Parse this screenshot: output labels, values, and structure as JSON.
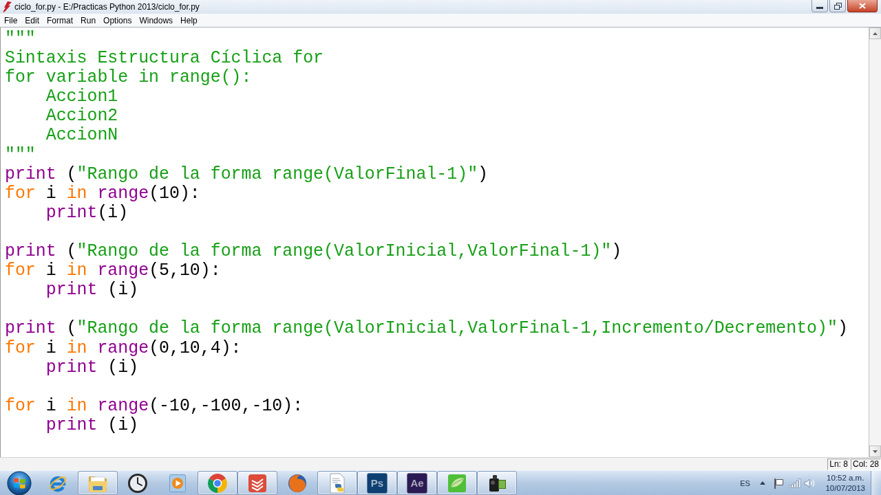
{
  "window": {
    "title": "ciclo_for.py - E:/Practicas Python 2013/ciclo_for.py"
  },
  "menu": [
    "File",
    "Edit",
    "Format",
    "Run",
    "Options",
    "Windows",
    "Help"
  ],
  "editor": {
    "lines": [
      {
        "kind": "code",
        "tokens": [
          {
            "kind": "string",
            "text": "\"\"\""
          }
        ]
      },
      {
        "kind": "code",
        "tokens": [
          {
            "kind": "string",
            "text": "Sintaxis Estructura Cíclica for"
          }
        ]
      },
      {
        "kind": "code",
        "tokens": [
          {
            "kind": "string",
            "text": "for variable in range():"
          }
        ],
        "children": [
          {
            "kind": "code",
            "tokens": [
              {
                "kind": "string",
                "text": "Accion1"
              }
            ]
          },
          {
            "kind": "code",
            "tokens": [
              {
                "kind": "string",
                "text": "Accion2"
              }
            ]
          },
          {
            "kind": "code",
            "tokens": [
              {
                "kind": "string",
                "text": "AccionN"
              }
            ]
          }
        ]
      },
      {
        "kind": "code",
        "tokens": [
          {
            "kind": "string",
            "text": "\"\"\""
          }
        ]
      },
      {
        "kind": "code",
        "tokens": [
          {
            "kind": "builtin",
            "text": "print"
          },
          {
            "kind": "plain",
            "text": " ("
          },
          {
            "kind": "string",
            "text": "\"Rango de la forma range(ValorFinal-1)\""
          },
          {
            "kind": "plain",
            "text": ")"
          }
        ]
      },
      {
        "kind": "code",
        "tokens": [
          {
            "kind": "keyword",
            "text": "for"
          },
          {
            "kind": "plain",
            "text": " i "
          },
          {
            "kind": "keyword",
            "text": "in "
          },
          {
            "kind": "builtin",
            "text": "range"
          },
          {
            "kind": "plain",
            "text": "(10):"
          }
        ],
        "children": [
          {
            "kind": "code",
            "tokens": [
              {
                "kind": "builtin",
                "text": "print"
              },
              {
                "kind": "plain",
                "text": "(i)"
              }
            ]
          }
        ]
      },
      {
        "kind": "blank"
      },
      {
        "kind": "code",
        "tokens": [
          {
            "kind": "builtin",
            "text": "print"
          },
          {
            "kind": "plain",
            "text": " ("
          },
          {
            "kind": "string",
            "text": "\"Rango de la forma range(ValorInicial,ValorFinal-1)\""
          },
          {
            "kind": "plain",
            "text": ")"
          }
        ]
      },
      {
        "kind": "code",
        "tokens": [
          {
            "kind": "keyword",
            "text": "for"
          },
          {
            "kind": "plain",
            "text": " i "
          },
          {
            "kind": "keyword",
            "text": "in "
          },
          {
            "kind": "builtin",
            "text": "range"
          },
          {
            "kind": "plain",
            "text": "(5,10):"
          }
        ],
        "children": [
          {
            "kind": "code",
            "tokens": [
              {
                "kind": "builtin",
                "text": "print"
              },
              {
                "kind": "plain",
                "text": " (i)"
              }
            ]
          }
        ]
      },
      {
        "kind": "blank"
      },
      {
        "kind": "code",
        "tokens": [
          {
            "kind": "builtin",
            "text": "print"
          },
          {
            "kind": "plain",
            "text": " ("
          },
          {
            "kind": "string",
            "text": "\"Rango de la forma range(ValorInicial,ValorFinal-1,Incremento/Decremento)\""
          },
          {
            "kind": "plain",
            "text": ")"
          }
        ]
      },
      {
        "kind": "code",
        "tokens": [
          {
            "kind": "keyword",
            "text": "for"
          },
          {
            "kind": "plain",
            "text": " i "
          },
          {
            "kind": "keyword",
            "text": "in "
          },
          {
            "kind": "builtin",
            "text": "range"
          },
          {
            "kind": "plain",
            "text": "(0,10,4):"
          }
        ],
        "children": [
          {
            "kind": "code",
            "tokens": [
              {
                "kind": "builtin",
                "text": "print"
              },
              {
                "kind": "plain",
                "text": " (i)"
              }
            ]
          }
        ]
      },
      {
        "kind": "blank"
      },
      {
        "kind": "code",
        "tokens": [
          {
            "kind": "keyword",
            "text": "for"
          },
          {
            "kind": "plain",
            "text": " i "
          },
          {
            "kind": "keyword",
            "text": "in "
          },
          {
            "kind": "builtin",
            "text": "range"
          },
          {
            "kind": "plain",
            "text": "(-10,-100,-10):"
          }
        ],
        "children": [
          {
            "kind": "code",
            "tokens": [
              {
                "kind": "builtin",
                "text": "print"
              },
              {
                "kind": "plain",
                "text": " (i)"
              }
            ]
          }
        ]
      }
    ]
  },
  "status_bar": {
    "line": "Ln: 8",
    "column": "Col: 28"
  },
  "taskbar": {
    "apps": [
      {
        "kind": "e-globe",
        "running": false
      },
      {
        "kind": "folder",
        "running": true
      },
      {
        "kind": "clock",
        "running": false
      },
      {
        "kind": "media",
        "running": false
      },
      {
        "kind": "round-logo",
        "running": true
      },
      {
        "kind": "checklist",
        "running": true
      },
      {
        "kind": "fox-globe",
        "running": false
      },
      {
        "kind": "snake-document",
        "running": true
      },
      {
        "kind": "letter-tile",
        "label": "Ps",
        "color": "#0d3f72",
        "running": true
      },
      {
        "kind": "letter-tile",
        "label": "Ae",
        "color": "#2b1b54",
        "running": true
      },
      {
        "kind": "leaf-tile",
        "running": true
      },
      {
        "kind": "camcorder",
        "running": true
      }
    ],
    "tray": {
      "language": "ES",
      "time": "10:52 a.m.",
      "date": "10/07/2013"
    }
  }
}
